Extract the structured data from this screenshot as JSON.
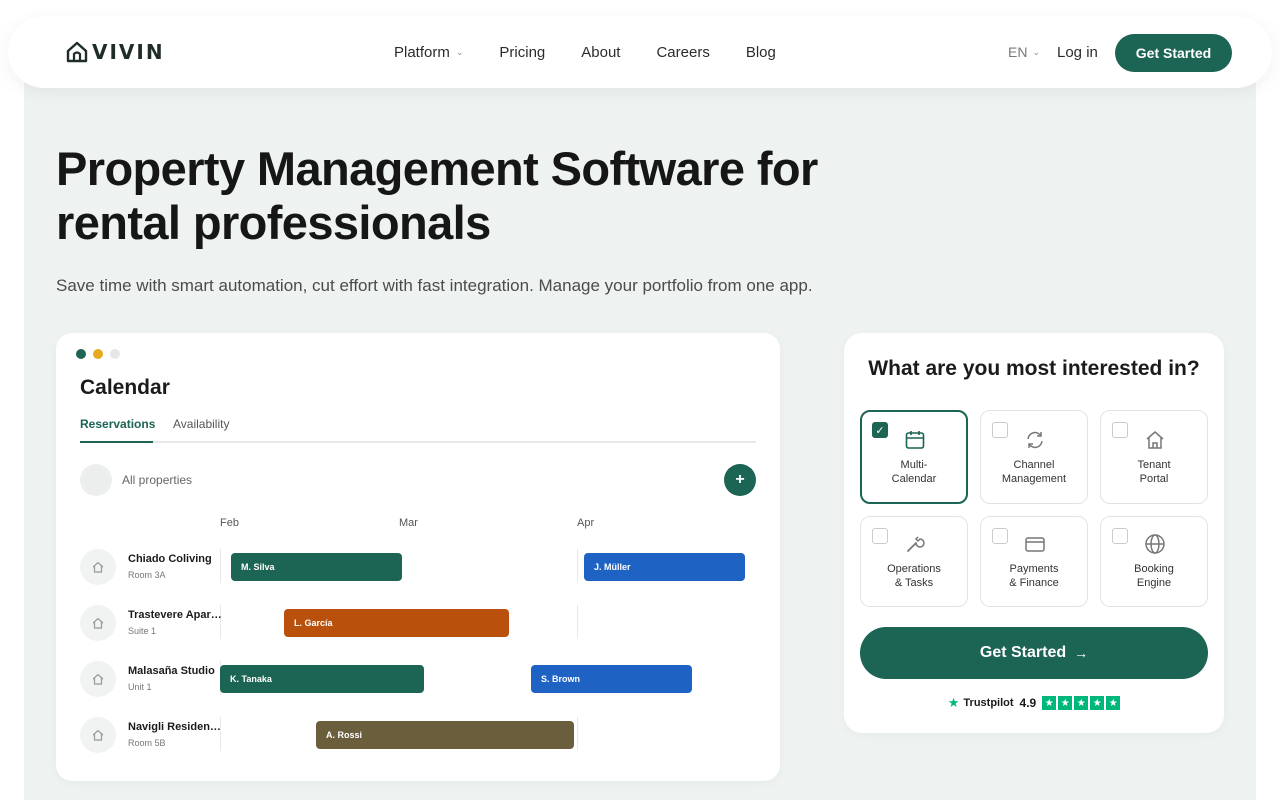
{
  "nav": {
    "logo_text": "VIVIN",
    "links": [
      {
        "label": "Platform",
        "has_dropdown": true
      },
      {
        "label": "Pricing"
      },
      {
        "label": "About"
      },
      {
        "label": "Careers"
      },
      {
        "label": "Blog"
      }
    ],
    "language": "EN",
    "login_label": "Log in",
    "cta_label": "Get Started"
  },
  "hero": {
    "headline_line1": "Property Management Software for",
    "headline_line2": "rental professionals",
    "subheadline": "Save time with smart automation, cut effort with fast integration. Manage your portfolio from one app."
  },
  "calendar": {
    "title": "Calendar",
    "tabs": [
      "Reservations",
      "Availability"
    ],
    "active_tab": "Reservations",
    "filter_label": "All properties",
    "add_icon": "+",
    "months": [
      "Feb",
      "Mar",
      "Apr"
    ],
    "properties": [
      {
        "name": "Chiado Coliving",
        "unit": "Room 3A"
      },
      {
        "name": "Trastevere Apart…",
        "unit": "Suite 1"
      },
      {
        "name": "Malasaña Studio",
        "unit": "Unit 1"
      },
      {
        "name": "Navigli Residence",
        "unit": "Room 5B"
      }
    ],
    "bookings": [
      {
        "guest": "M. Silva",
        "row": 0,
        "color": "#1c6453"
      },
      {
        "guest": "J. Müller",
        "row": 0,
        "color": "#1e63c4"
      },
      {
        "guest": "L. García",
        "row": 1,
        "color": "#b9500c"
      },
      {
        "guest": "K. Tanaka",
        "row": 2,
        "color": "#1c6453"
      },
      {
        "guest": "S. Brown",
        "row": 2,
        "color": "#1e63c4"
      },
      {
        "guest": "A. Rossi",
        "row": 3,
        "color": "#6b5e3c"
      }
    ]
  },
  "interest": {
    "title": "What are you most interested in?",
    "options": [
      {
        "line1": "Multi-",
        "line2": "Calendar",
        "icon": "calendar-icon",
        "selected": true
      },
      {
        "line1": "Channel",
        "line2": "Management",
        "icon": "sync-icon",
        "selected": false
      },
      {
        "line1": "Tenant",
        "line2": "Portal",
        "icon": "home-icon",
        "selected": false
      },
      {
        "line1": "Operations",
        "line2": "& Tasks",
        "icon": "wrench-icon",
        "selected": false
      },
      {
        "line1": "Payments",
        "line2": "& Finance",
        "icon": "credit-card-icon",
        "selected": false
      },
      {
        "line1": "Booking",
        "line2": "Engine",
        "icon": "globe-icon",
        "selected": false
      }
    ],
    "cta_label": "Get Started",
    "trustpilot_label": "Trustpilot",
    "rating": "4.9"
  },
  "colors": {
    "brand": "#1c6453",
    "dot_green": "#1c6453",
    "dot_yellow": "#e8a91c",
    "dot_gray": "#e5e7e6"
  }
}
